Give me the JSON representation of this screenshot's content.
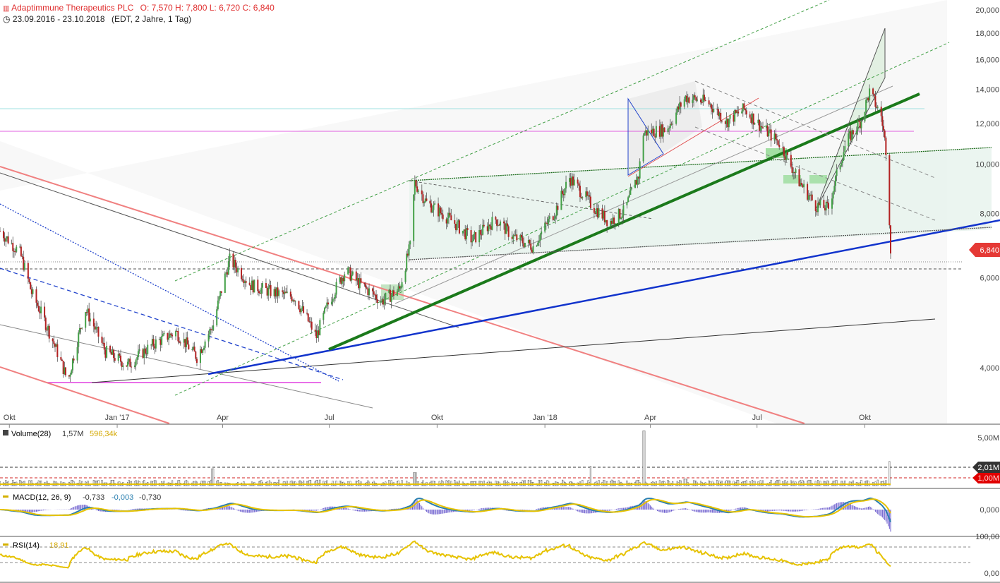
{
  "header": {
    "title": "Adaptimmune Therapeutics PLC",
    "ohlc": "O: 7,570  H: 7,800  L: 6,720  C: 6,840",
    "range": "23.09.2016 - 23.10.2018",
    "range_info": "(EDT, 2 Jahre, 1 Tag)"
  },
  "colors": {
    "up": "#43a047",
    "down": "#b22222",
    "accent": "#e53935",
    "volume_ma": "#e6c200"
  },
  "chart_data": [
    {
      "type": "line",
      "title": "Adaptimmune Therapeutics PLC",
      "scale": "log",
      "ylim": [
        3.2,
        21
      ],
      "y_ticks": [
        "20,000",
        "18,000",
        "16,000",
        "14,000",
        "12,000",
        "10,000",
        "8,000",
        "6,000",
        "4,000"
      ],
      "x_ticks": [
        "Okt",
        "Jan '17",
        "Apr",
        "Jul",
        "Okt",
        "Jan '18",
        "Apr",
        "Jul",
        "Okt"
      ],
      "last_price_label": "6,840",
      "x": [
        "2016-09-23",
        "2016-10-10",
        "2016-10-20",
        "2016-11-04",
        "2016-11-20",
        "2016-12-05",
        "2016-12-22",
        "2017-01-10",
        "2017-02-01",
        "2017-02-20",
        "2017-03-10",
        "2017-03-24",
        "2017-04-07",
        "2017-04-25",
        "2017-05-15",
        "2017-06-01",
        "2017-06-20",
        "2017-07-01",
        "2017-07-15",
        "2017-07-28",
        "2017-08-15",
        "2017-08-30",
        "2017-09-08",
        "2017-09-12",
        "2017-09-22",
        "2017-10-15",
        "2017-10-31",
        "2017-11-20",
        "2017-12-05",
        "2017-12-22",
        "2018-01-10",
        "2018-01-22",
        "2018-02-10",
        "2018-02-25",
        "2018-03-10",
        "2018-03-22",
        "2018-03-26",
        "2018-04-15",
        "2018-05-01",
        "2018-05-20",
        "2018-06-05",
        "2018-06-20",
        "2018-07-05",
        "2018-07-20",
        "2018-08-05",
        "2018-08-20",
        "2018-08-31",
        "2018-09-15",
        "2018-09-28",
        "2018-10-05",
        "2018-10-15",
        "2018-10-19",
        "2018-10-23"
      ],
      "series": [
        {
          "values": [
            7.4,
            6.7,
            5.6,
            4.7,
            3.75,
            5.2,
            4.3,
            4.05,
            4.45,
            4.7,
            4.2,
            4.85,
            6.5,
            5.8,
            5.6,
            5.5,
            4.6,
            5.4,
            6.2,
            5.8,
            5.4,
            5.7,
            6.9,
            9.2,
            8.4,
            7.7,
            7.1,
            7.8,
            7.2,
            6.9,
            8.1,
            9.4,
            8.3,
            7.7,
            8.1,
            9.5,
            11.5,
            11.7,
            13.5,
            13.2,
            12.1,
            12.8,
            11.8,
            11.0,
            9.3,
            8.3,
            8.2,
            11.0,
            12.2,
            13.8,
            12.4,
            10.7,
            6.84
          ]
        }
      ]
    },
    {
      "type": "bar",
      "title": "Volume(28)",
      "legend": [
        "1,57M",
        "596,34k"
      ],
      "y_ticks": [
        "5,00M"
      ],
      "marker_labels": [
        "2,01M",
        "1,00M"
      ],
      "x": [
        "2016-09-23",
        "2016-11-04",
        "2016-12-22",
        "2017-02-20",
        "2017-03-24",
        "2017-05-15",
        "2017-07-15",
        "2017-09-12",
        "2017-10-31",
        "2017-12-22",
        "2018-02-10",
        "2018-03-26",
        "2018-05-01",
        "2018-06-20",
        "2018-08-05",
        "2018-09-15",
        "2018-10-15",
        "2018-10-22"
      ],
      "values": [
        0.5,
        0.3,
        0.35,
        0.3,
        2.1,
        0.4,
        0.3,
        1.6,
        0.5,
        0.4,
        2.4,
        6.8,
        0.8,
        0.5,
        0.5,
        0.6,
        0.5,
        3.0
      ]
    },
    {
      "type": "line",
      "title": "MACD(12, 26, 9)",
      "legend": [
        "-0,733",
        "-0,003",
        "-0,730"
      ],
      "y_ticks": [
        "0,000"
      ]
    },
    {
      "type": "line",
      "title": "RSI(14)",
      "legend": [
        "18,91"
      ],
      "y_ticks": [
        "100,00",
        "0,00"
      ]
    }
  ]
}
